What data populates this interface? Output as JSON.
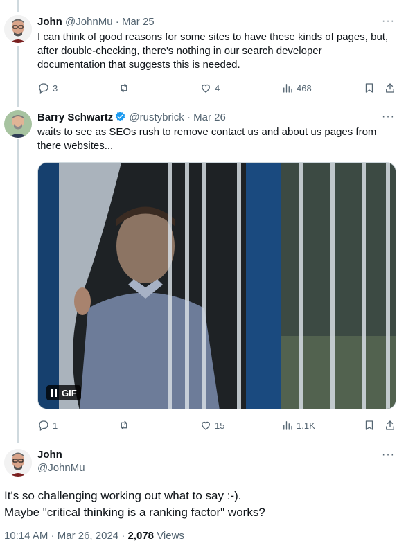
{
  "tweets": [
    {
      "name": "John",
      "handle": "@JohnMu",
      "sep": "·",
      "date": "Mar 25",
      "text": "I can think of good reasons for some sites to have these kinds of pages, but, after double-checking, there's nothing in our search developer documentation that suggests this is needed.",
      "replies": "3",
      "retweets": "",
      "likes": "4",
      "views": "468"
    },
    {
      "name": "Barry Schwartz",
      "handle": "@rustybrick",
      "sep": "·",
      "date": "Mar 26",
      "text": "waits to see as SEOs rush to remove contact us and about us pages from there websites...",
      "replies": "1",
      "retweets": "",
      "likes": "15",
      "views": "1.1K",
      "media_badge": "GIF"
    }
  ],
  "main": {
    "name": "John",
    "handle": "@JohnMu",
    "line1": "It's so challenging working out what to say :-).",
    "line2": "Maybe \"critical thinking is a ranking factor\" works?",
    "time": "10:14 AM",
    "date": "Mar 26, 2024",
    "views_count": "2,078",
    "views_label": "Views",
    "sep": "·"
  },
  "more_label": "···",
  "colors": {
    "accent": "#1d9bf0",
    "muted": "#536471",
    "text": "#0f1419"
  }
}
